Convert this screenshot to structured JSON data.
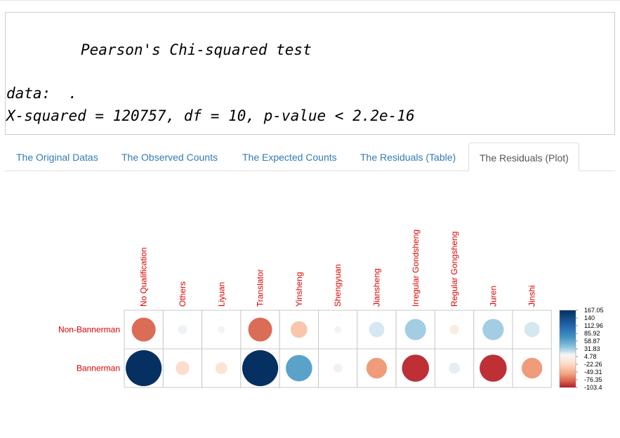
{
  "output": {
    "test_title": "Pearson's Chi-squared test",
    "data_line": "data:  .",
    "stat_line": "X-squared = 120757, df = 10, p-value < 2.2e-16"
  },
  "tabs": [
    {
      "label": "The Original Datas",
      "active": false
    },
    {
      "label": "The Observed Counts",
      "active": false
    },
    {
      "label": "The Expected Counts",
      "active": false
    },
    {
      "label": "The Residuals (Table)",
      "active": false
    },
    {
      "label": "The Residuals (Plot)",
      "active": true
    }
  ],
  "chart_data": {
    "type": "heatmap",
    "columns": [
      "No Qualification",
      "Others",
      "Liyuan",
      "Translator",
      "Yinsheng",
      "Shengyuan",
      "Jiansheng",
      "Irregular Gondsheng",
      "Regular Gongsheng",
      "Juren",
      "Jinshi"
    ],
    "rows": [
      "Non-Bannerman",
      "Bannerman"
    ],
    "values": [
      [
        -73,
        10,
        6,
        -73,
        -36,
        -6,
        30,
        58,
        -11,
        58,
        30
      ],
      [
        167,
        -24,
        -18,
        167,
        90,
        10,
        -55,
        -95,
        16,
        -95,
        -55
      ]
    ],
    "scale_labels": [
      "167.05",
      "140",
      "112.96",
      "85.92",
      "58.87",
      "31.83",
      "4.78",
      "-22.26",
      "-49.31",
      "-76.35",
      "-103.4"
    ],
    "scale_range": [
      -103.4,
      167.05
    ],
    "colors": {
      "negative": "#b2182b",
      "neutral": "#ffffff",
      "positive": "#053061"
    }
  }
}
